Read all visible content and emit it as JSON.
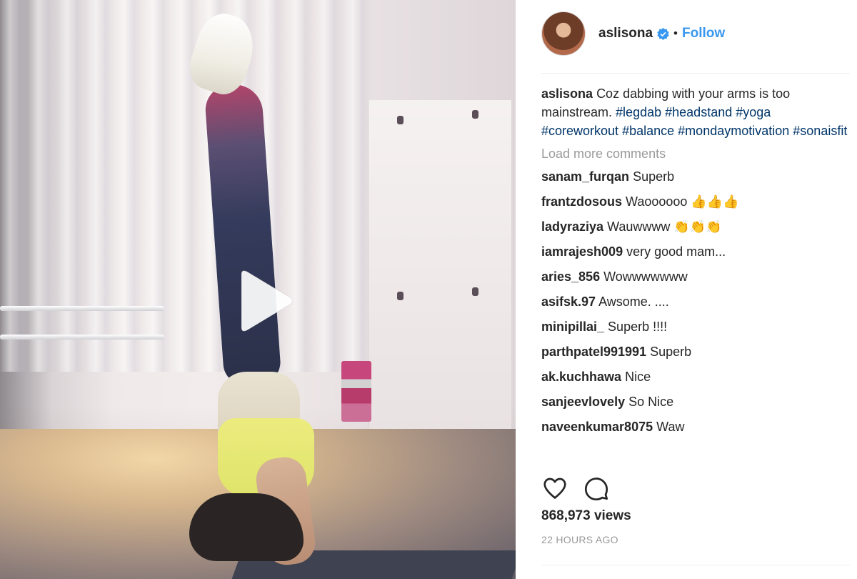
{
  "post": {
    "username": "aslisona",
    "follow_label": "Follow",
    "separator": "•",
    "icons": {
      "verified": "verified-badge-icon",
      "play": "play-icon",
      "like": "heart-icon",
      "comment": "comment-icon"
    },
    "colors": {
      "link": "#3897f0",
      "hashtag": "#003569",
      "muted": "#999999",
      "text": "#262626"
    }
  },
  "caption": {
    "username": "aslisona",
    "text": "Coz dabbing with your arms is too mainstream.",
    "hashtags": [
      "#legdab",
      "#headstand",
      "#yoga",
      "#coreworkout",
      "#balance",
      "#mondaymotivation",
      "#sonaisfit"
    ]
  },
  "load_more": "Load more comments",
  "comments": [
    {
      "user": "sanam_furqan",
      "text": "Superb"
    },
    {
      "user": "frantzdosous",
      "text": "Waoooooo 👍👍👍"
    },
    {
      "user": "ladyraziya",
      "text": "Wauwwww 👏👏👏"
    },
    {
      "user": "iamrajesh009",
      "text": "very good mam..."
    },
    {
      "user": "aries_856",
      "text": "Wowwwwwww"
    },
    {
      "user": "asifsk.97",
      "text": "Awsome. ...."
    },
    {
      "user": "minipillai_",
      "text": "Superb !!!!"
    },
    {
      "user": "parthpatel991991",
      "text": "Superb"
    },
    {
      "user": "ak.kuchhawa",
      "text": "Nice"
    },
    {
      "user": "sanjeevlovely",
      "text": "So Nice"
    },
    {
      "user": "naveenkumar8075",
      "text": "Waw"
    }
  ],
  "stats": {
    "views": "868,973 views",
    "time": "22 HOURS AGO"
  }
}
